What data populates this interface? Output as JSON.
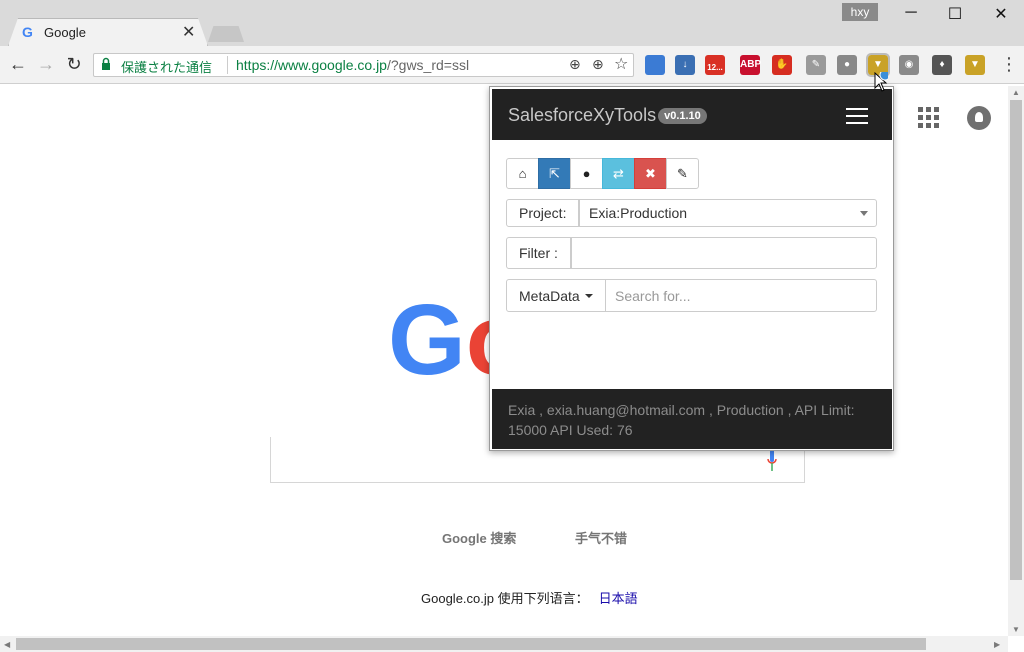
{
  "browser": {
    "tab": {
      "title": "Google",
      "favicon": "G",
      "close": "✕"
    },
    "profile_label": "hxy",
    "window_controls": {
      "minimize": "─",
      "maximize": "☐",
      "close": "✕"
    },
    "nav": {
      "back": "←",
      "forward": "→",
      "reload": "↻"
    },
    "omnibox": {
      "secure_label": "保護された通信",
      "url_main": "https://www.google.co.jp",
      "url_rest": "/?gws_rd=ssl"
    },
    "omni_icons": {
      "location": "⊕",
      "zoom": "⊕",
      "star": "☆"
    },
    "extensions": [
      {
        "name": "extension-1",
        "label": "",
        "color": "#3b7bd4"
      },
      {
        "name": "download-extension",
        "label": "↓",
        "color": "#3a6fb3"
      },
      {
        "name": "gmail-extension",
        "label": "12...",
        "color": "#d93025"
      },
      {
        "name": "adblock-plus-extension",
        "label": "ABP",
        "color": "#c8102e"
      },
      {
        "name": "stop-extension",
        "label": "✋",
        "color": "#d62d20"
      },
      {
        "name": "notes-extension",
        "label": "✎",
        "color": "#9a9a9a"
      },
      {
        "name": "chat-extension",
        "label": "●",
        "color": "#888888"
      },
      {
        "name": "salesforce-xy-tools-extension",
        "label": "▼",
        "color": "#c9a227"
      },
      {
        "name": "screenshot-extension",
        "label": "◉",
        "color": "#8a8a8a"
      },
      {
        "name": "evernote-extension",
        "label": "♦",
        "color": "#555555"
      },
      {
        "name": "extension-11",
        "label": "▼",
        "color": "#c9a227"
      }
    ],
    "menu": "⋮"
  },
  "page": {
    "logo_part1": "G",
    "logo_part2": "o",
    "search_button": "Google 搜索",
    "lucky_button": "手气不错",
    "lang_prefix": "Google.co.jp 使用下列语言：",
    "lang_link": "日本語"
  },
  "popup": {
    "brand": "SalesforceXyTools",
    "version": "v0.1.10",
    "buttons": [
      {
        "name": "home-button",
        "icon": "⌂",
        "style": "default"
      },
      {
        "name": "open-external-button",
        "icon": "⇱",
        "style": "primary"
      },
      {
        "name": "user-button",
        "icon": "●",
        "style": "default"
      },
      {
        "name": "switch-button",
        "icon": "⇄",
        "style": "info"
      },
      {
        "name": "delete-button",
        "icon": "✖",
        "style": "danger"
      },
      {
        "name": "settings-button",
        "icon": "✎",
        "style": "default"
      }
    ],
    "project_label": "Project:",
    "project_value": "Exia:Production",
    "filter_label": "Filter :",
    "filter_value": "",
    "metadata_label": "MetaData",
    "search_placeholder": "Search for...",
    "footer_text": "Exia , exia.huang@hotmail.com , Production , API Limit: 15000 API Used: 76"
  }
}
